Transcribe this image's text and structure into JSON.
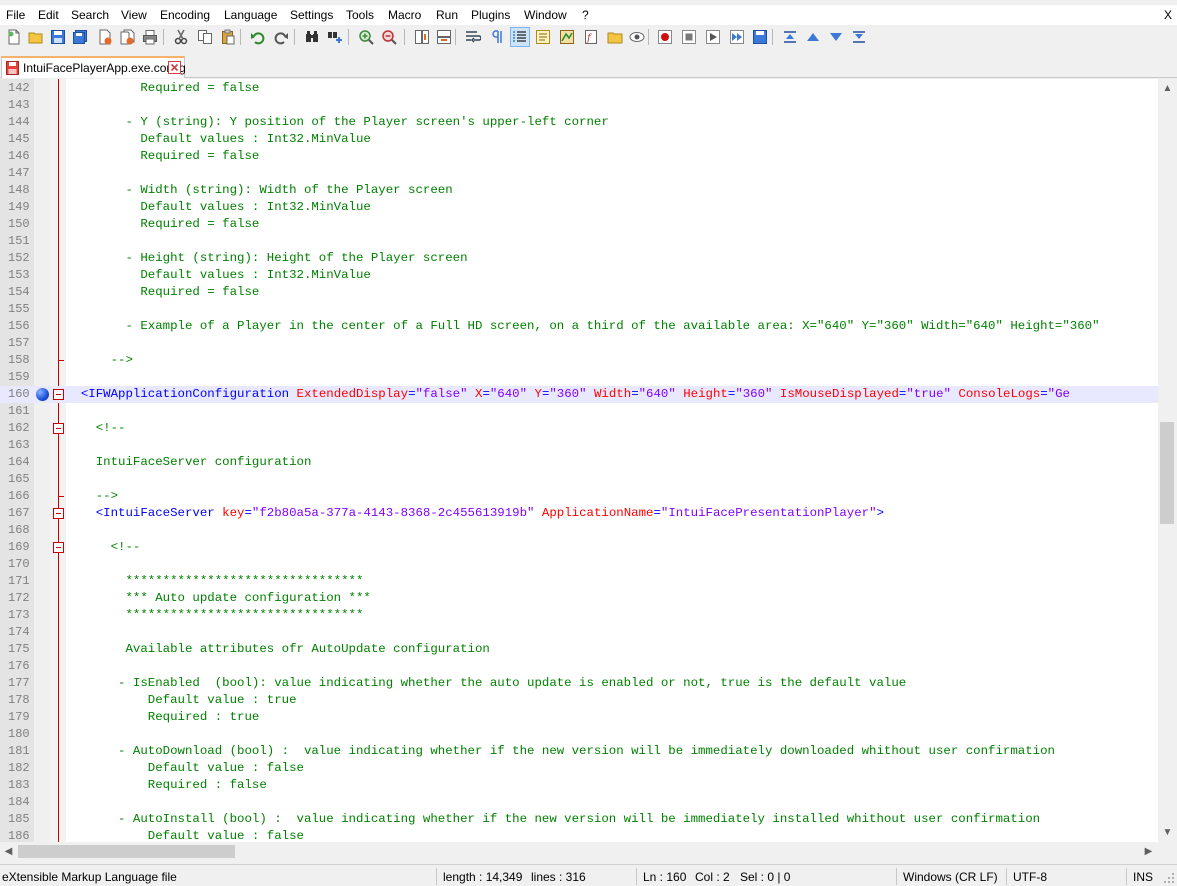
{
  "menu": {
    "items": [
      "File",
      "Edit",
      "Search",
      "View",
      "Encoding",
      "Language",
      "Settings",
      "Tools",
      "Macro",
      "Run",
      "Plugins",
      "Window",
      "?"
    ],
    "close_label": "X"
  },
  "toolbar": {
    "icons": [
      "new-file-icon",
      "open-file-icon",
      "save-icon",
      "save-all-icon",
      "close-icon",
      "close-all-icon",
      "print-icon",
      "cut-icon",
      "copy-icon",
      "paste-icon",
      "undo-icon",
      "redo-icon",
      "find-icon",
      "replace-icon",
      "zoom-in-icon",
      "zoom-out-icon",
      "sync-vertical-icon",
      "sync-horizontal-icon",
      "word-wrap-icon",
      "show-all-chars-icon",
      "indent-guide-icon",
      "udl-icon",
      "doc-map-icon",
      "function-list-icon",
      "folder-workspace-icon",
      "monitor-icon",
      "record-macro-icon",
      "stop-record-icon",
      "play-macro-icon",
      "run-macro-multiple-icon",
      "save-macro-icon",
      "fold-all-icon",
      "prev-bookmark-icon",
      "next-bookmark-icon",
      "unfold-all-icon"
    ],
    "active": "indent-guide-icon"
  },
  "tab": {
    "name": "IntuiFacePlayerApp.exe.config",
    "icon": "red-disk-icon",
    "close_icon": "tab-close-icon"
  },
  "editor": {
    "current_line": "160",
    "lines": [
      {
        "n": "142",
        "segs": [
          [
            "cmt",
            "          Required = false"
          ]
        ]
      },
      {
        "n": "143",
        "segs": []
      },
      {
        "n": "144",
        "segs": [
          [
            "cmt",
            "        - Y (string): Y position of the Player screen's upper-left corner"
          ]
        ]
      },
      {
        "n": "145",
        "segs": [
          [
            "cmt",
            "          Default values : Int32.MinValue"
          ]
        ]
      },
      {
        "n": "146",
        "segs": [
          [
            "cmt",
            "          Required = false"
          ]
        ]
      },
      {
        "n": "147",
        "segs": []
      },
      {
        "n": "148",
        "segs": [
          [
            "cmt",
            "        - Width (string): Width of the Player screen"
          ]
        ]
      },
      {
        "n": "149",
        "segs": [
          [
            "cmt",
            "          Default values : Int32.MinValue"
          ]
        ]
      },
      {
        "n": "150",
        "segs": [
          [
            "cmt",
            "          Required = false"
          ]
        ]
      },
      {
        "n": "151",
        "segs": []
      },
      {
        "n": "152",
        "segs": [
          [
            "cmt",
            "        - Height (string): Height of the Player screen"
          ]
        ]
      },
      {
        "n": "153",
        "segs": [
          [
            "cmt",
            "          Default values : Int32.MinValue"
          ]
        ]
      },
      {
        "n": "154",
        "segs": [
          [
            "cmt",
            "          Required = false"
          ]
        ]
      },
      {
        "n": "155",
        "segs": []
      },
      {
        "n": "156",
        "segs": [
          [
            "cmt",
            "        - Example of a Player in the center of a Full HD screen, on a third of the available area: X=\"640\" Y=\"360\" Width=\"640\" Height=\"360\""
          ]
        ]
      },
      {
        "n": "157",
        "segs": []
      },
      {
        "n": "158",
        "segs": [
          [
            "cmt",
            "      -->"
          ]
        ],
        "foldend": true
      },
      {
        "n": "159",
        "segs": []
      },
      {
        "n": "160",
        "segs": [
          [
            "tag",
            "  <IFWApplicationConfiguration"
          ],
          [
            "attr",
            " ExtendedDisplay"
          ],
          [
            "tag",
            "="
          ],
          [
            "val",
            "\"false\""
          ],
          [
            "attr",
            " X"
          ],
          [
            "tag",
            "="
          ],
          [
            "val",
            "\"640\""
          ],
          [
            "attr",
            " Y"
          ],
          [
            "tag",
            "="
          ],
          [
            "val",
            "\"360\""
          ],
          [
            "attr",
            " Width"
          ],
          [
            "tag",
            "="
          ],
          [
            "val",
            "\"640\""
          ],
          [
            "attr",
            " Height"
          ],
          [
            "tag",
            "="
          ],
          [
            "val",
            "\"360\""
          ],
          [
            "attr",
            " IsMouseDisplayed"
          ],
          [
            "tag",
            "="
          ],
          [
            "val",
            "\"true\""
          ],
          [
            "attr",
            " ConsoleLogs"
          ],
          [
            "tag",
            "="
          ],
          [
            "val",
            "\"Ge"
          ]
        ],
        "fold": true,
        "bookmark": true,
        "current": true
      },
      {
        "n": "161",
        "segs": []
      },
      {
        "n": "162",
        "segs": [
          [
            "cmt",
            "    <!--"
          ]
        ],
        "fold": true
      },
      {
        "n": "163",
        "segs": []
      },
      {
        "n": "164",
        "segs": [
          [
            "cmt",
            "    IntuiFaceServer configuration"
          ]
        ]
      },
      {
        "n": "165",
        "segs": []
      },
      {
        "n": "166",
        "segs": [
          [
            "cmt",
            "    -->"
          ]
        ],
        "foldend": true
      },
      {
        "n": "167",
        "segs": [
          [
            "tag",
            "    <IntuiFaceServer"
          ],
          [
            "attr",
            " key"
          ],
          [
            "tag",
            "="
          ],
          [
            "val",
            "\"f2b80a5a-377a-4143-8368-2c455613919b\""
          ],
          [
            "attr",
            " ApplicationName"
          ],
          [
            "tag",
            "="
          ],
          [
            "val",
            "\"IntuiFacePresentationPlayer\""
          ],
          [
            "tag",
            ">"
          ]
        ],
        "fold": true
      },
      {
        "n": "168",
        "segs": []
      },
      {
        "n": "169",
        "segs": [
          [
            "cmt",
            "      <!--"
          ]
        ],
        "fold": true
      },
      {
        "n": "170",
        "segs": []
      },
      {
        "n": "171",
        "segs": [
          [
            "cmt",
            "        ********************************"
          ]
        ]
      },
      {
        "n": "172",
        "segs": [
          [
            "cmt",
            "        *** Auto update configuration ***"
          ]
        ]
      },
      {
        "n": "173",
        "segs": [
          [
            "cmt",
            "        ********************************"
          ]
        ]
      },
      {
        "n": "174",
        "segs": []
      },
      {
        "n": "175",
        "segs": [
          [
            "cmt",
            "        Available attributes ofr AutoUpdate configuration"
          ]
        ]
      },
      {
        "n": "176",
        "segs": []
      },
      {
        "n": "177",
        "segs": [
          [
            "cmt",
            "       - IsEnabled  (bool): value indicating whether the auto update is enabled or not, true is the default value"
          ]
        ]
      },
      {
        "n": "178",
        "segs": [
          [
            "cmt",
            "           Default value : true"
          ]
        ]
      },
      {
        "n": "179",
        "segs": [
          [
            "cmt",
            "           Required : true"
          ]
        ]
      },
      {
        "n": "180",
        "segs": []
      },
      {
        "n": "181",
        "segs": [
          [
            "cmt",
            "       - AutoDownload (bool) :  value indicating whether if the new version will be immediately downloaded whithout user confirmation"
          ]
        ]
      },
      {
        "n": "182",
        "segs": [
          [
            "cmt",
            "           Default value : false"
          ]
        ]
      },
      {
        "n": "183",
        "segs": [
          [
            "cmt",
            "           Required : false"
          ]
        ]
      },
      {
        "n": "184",
        "segs": []
      },
      {
        "n": "185",
        "segs": [
          [
            "cmt",
            "       - AutoInstall (bool) :  value indicating whether if the new version will be immediately installed whithout user confirmation"
          ]
        ]
      },
      {
        "n": "186",
        "segs": [
          [
            "cmt",
            "           Default value : false"
          ]
        ]
      }
    ]
  },
  "status": {
    "file_type": "eXtensible Markup Language file",
    "length": "length : 14,349",
    "lines": "lines : 316",
    "ln": "Ln : 160",
    "col": "Col : 2",
    "sel": "Sel : 0 | 0",
    "eol": "Windows (CR LF)",
    "encoding": "UTF-8",
    "mode": "INS"
  },
  "colors": {
    "tag": "#0000ff",
    "attribute": "#ff0000",
    "value": "#8000ff",
    "comment": "#008000",
    "current_line_bg": "#e8e8ff",
    "fold_margin": "#cc0000"
  }
}
